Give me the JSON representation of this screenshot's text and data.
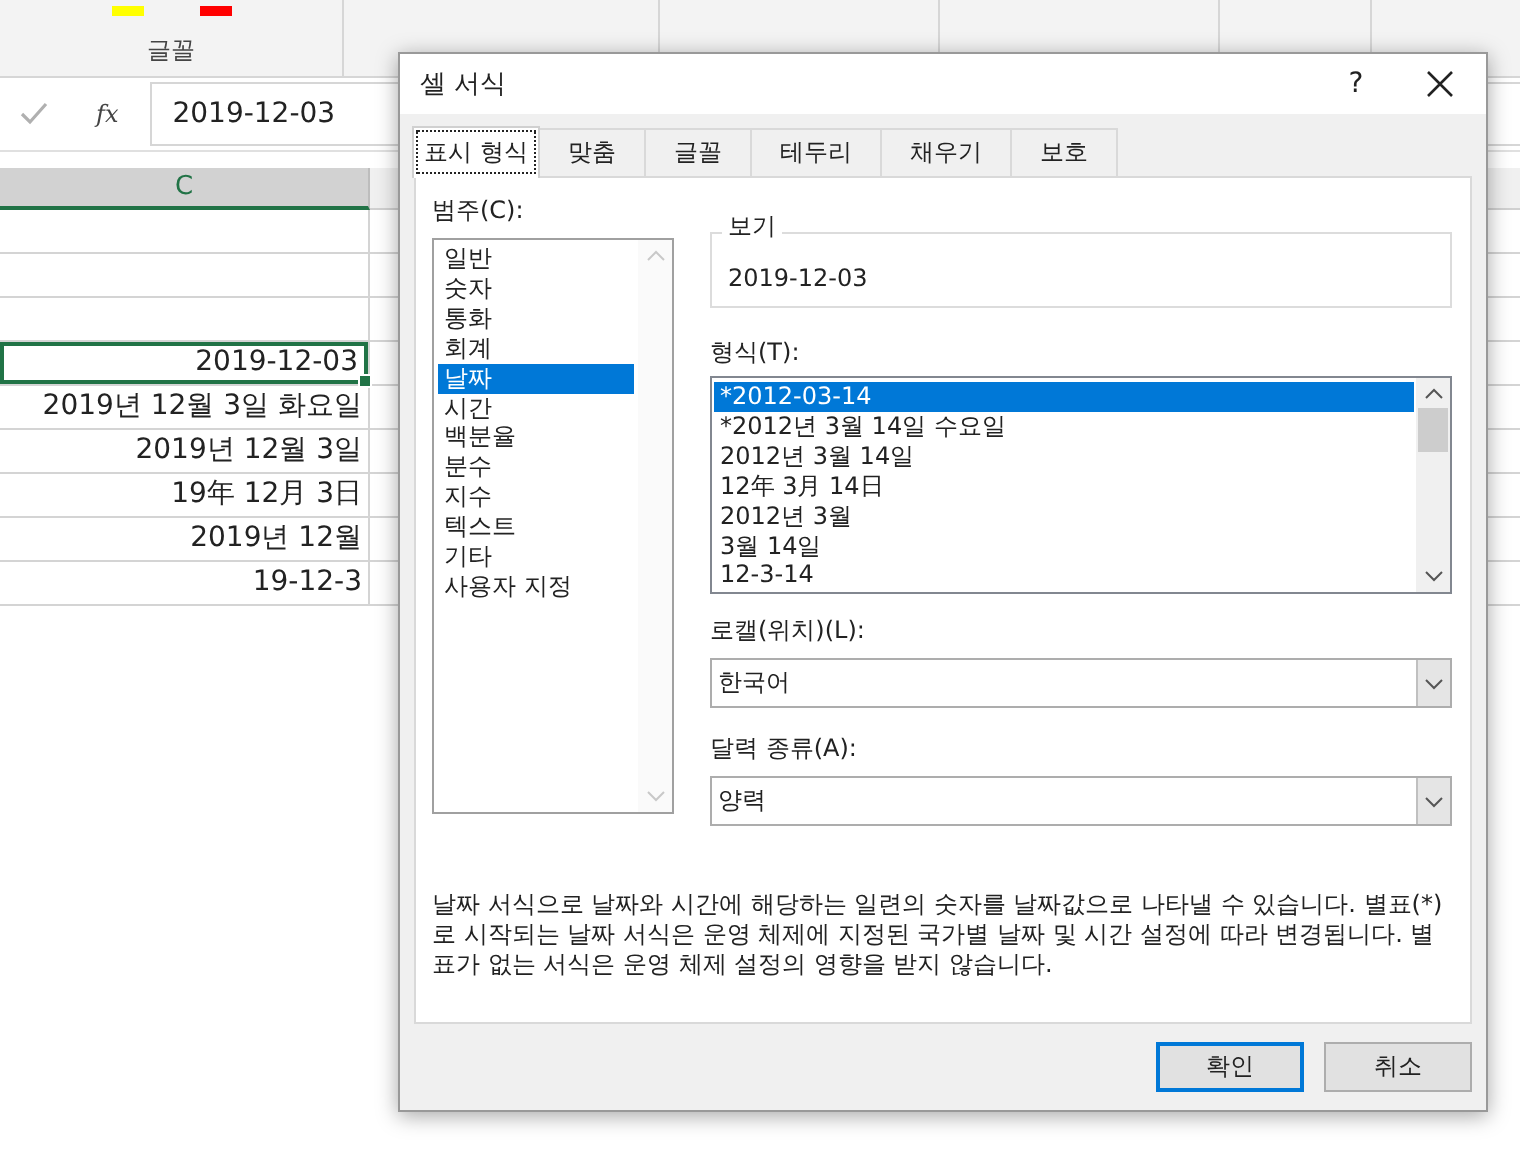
{
  "ribbon": {
    "groups": [
      "글꼴"
    ]
  },
  "formula_bar": {
    "fx": "fx",
    "value": "2019-12-03"
  },
  "sheet": {
    "column_header": "C",
    "cells": [
      {
        "text": "",
        "selected": false
      },
      {
        "text": "",
        "selected": false
      },
      {
        "text": "",
        "selected": false
      },
      {
        "text": "2019-12-03",
        "selected": true
      },
      {
        "text": "2019년 12월 3일 화요일",
        "selected": false
      },
      {
        "text": "2019년 12월 3일",
        "selected": false
      },
      {
        "text": "19年 12月 3日",
        "selected": false
      },
      {
        "text": "2019년 12월",
        "selected": false
      },
      {
        "text": "19-12-3",
        "selected": false
      }
    ]
  },
  "dialog": {
    "title": "셀 서식",
    "help": "?",
    "tabs": [
      {
        "label": "표시 형식",
        "selected": true
      },
      {
        "label": "맞춤",
        "selected": false
      },
      {
        "label": "글꼴",
        "selected": false
      },
      {
        "label": "테두리",
        "selected": false
      },
      {
        "label": "채우기",
        "selected": false
      },
      {
        "label": "보호",
        "selected": false
      }
    ],
    "category_label": "범주(C):",
    "categories": [
      {
        "label": "일반",
        "selected": false
      },
      {
        "label": "숫자",
        "selected": false
      },
      {
        "label": "통화",
        "selected": false
      },
      {
        "label": "회계",
        "selected": false
      },
      {
        "label": "날짜",
        "selected": true
      },
      {
        "label": "시간",
        "selected": false
      },
      {
        "label": "백분율",
        "selected": false
      },
      {
        "label": "분수",
        "selected": false
      },
      {
        "label": "지수",
        "selected": false
      },
      {
        "label": "텍스트",
        "selected": false
      },
      {
        "label": "기타",
        "selected": false
      },
      {
        "label": "사용자 지정",
        "selected": false
      }
    ],
    "sample_label": "보기",
    "sample": "2019-12-03",
    "format_label": "형식(T):",
    "formats": [
      {
        "label": "*2012-03-14",
        "selected": true
      },
      {
        "label": "*2012년 3월 14일 수요일",
        "selected": false
      },
      {
        "label": "2012년 3월 14일",
        "selected": false
      },
      {
        "label": "12年 3月 14日",
        "selected": false
      },
      {
        "label": "2012년 3월",
        "selected": false
      },
      {
        "label": "3월 14일",
        "selected": false
      },
      {
        "label": "12-3-14",
        "selected": false
      }
    ],
    "locale_label": "로캘(위치)(L):",
    "locale": "한국어",
    "calendar_label": "달력 종류(A):",
    "calendar": "양력",
    "description": "날짜 서식으로 날짜와 시간에 해당하는 일련의 숫자를 날짜값으로 나타낼 수 있습니다. 별표(*)로 시작되는 날짜 서식은 운영 체제에 지정된 국가별 날짜 및 시간 설정에 따라 변경됩니다. 별표가 없는 서식은 운영 체제 설정의 영향을 받지 않습니다.",
    "buttons": [
      {
        "label": "확인",
        "default": true
      },
      {
        "label": "취소",
        "default": false
      }
    ]
  }
}
